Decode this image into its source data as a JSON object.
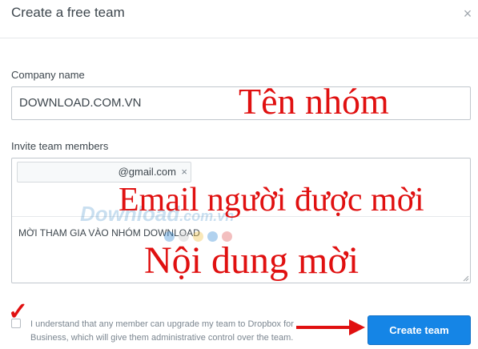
{
  "dialog": {
    "title": "Create a free team",
    "close_icon": "×"
  },
  "company": {
    "label": "Company name",
    "value": "DOWNLOAD.COM.VN"
  },
  "invite": {
    "label": "Invite team members",
    "email_chip": "@gmail.com",
    "chip_remove_icon": "×",
    "message": "MỜI THAM GIA VÀO NHÓM DOWNLOAD"
  },
  "agreement": {
    "text": "I understand that any member can upgrade my team to Dropbox for Business, which will give them administrative control over the team."
  },
  "actions": {
    "create_label": "Create team"
  },
  "annotations": {
    "team_name": "Tên nhóm",
    "invitee_email": "Email người được mời",
    "invite_content": "Nội dung mời",
    "checkmark": "✓",
    "color": "#e01010"
  },
  "watermark": {
    "text": "Download",
    "suffix": ".com.vn",
    "dot_colors": [
      "#3d8fd6",
      "#c7c7c7",
      "#f0c24a",
      "#3d8fd6",
      "#e06060"
    ]
  },
  "colors": {
    "accent": "#1585e6",
    "text": "#3d464d",
    "muted": "#7b8690"
  }
}
